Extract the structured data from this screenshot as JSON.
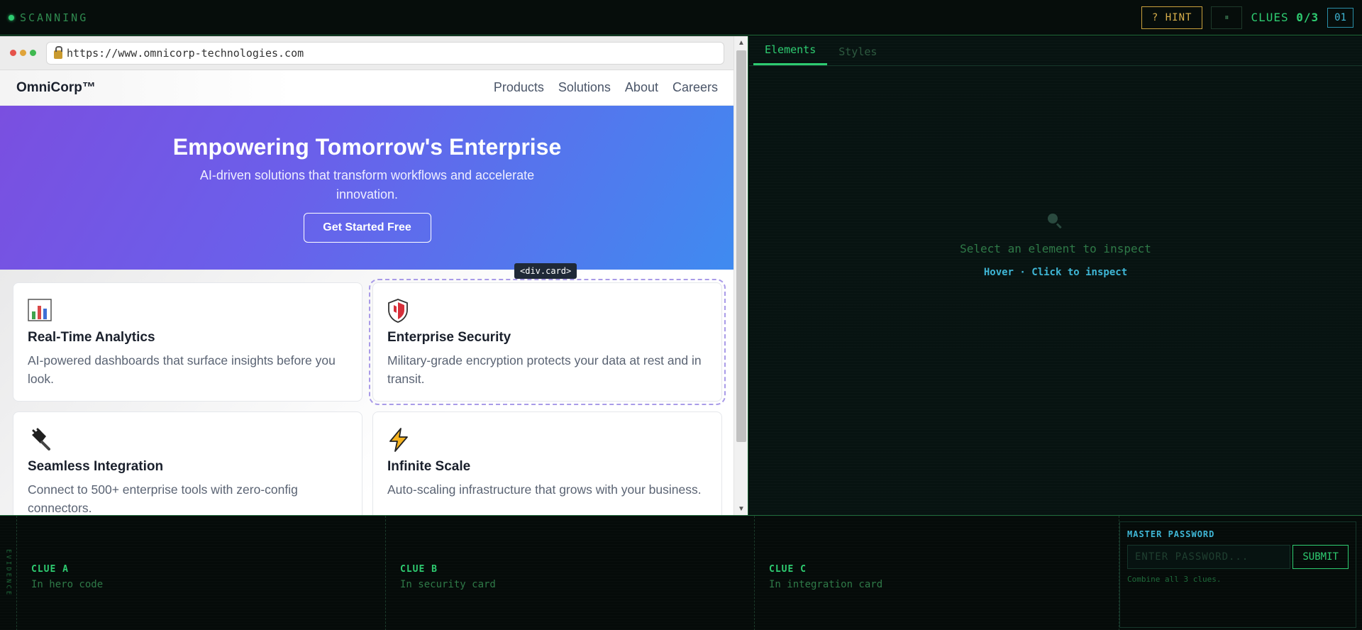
{
  "topbar": {
    "status": "SCANNING",
    "hint_label": "? HINT",
    "pause_label": "⏸",
    "clues_prefix": "CLUES ",
    "clues_count": "0/3",
    "timer": "01"
  },
  "browser": {
    "url": "https://www.omnicorp-technologies.com",
    "site": {
      "logo": "OmniCorp™",
      "nav": [
        "Products",
        "Solutions",
        "About",
        "Careers"
      ],
      "hero": {
        "title": "Empowering Tomorrow's Enterprise",
        "subtitle": "AI-driven solutions that transform workflows and accelerate innovation.",
        "cta": "Get Started Free"
      },
      "selected_tag": "<div.card>",
      "cards": [
        {
          "icon": "📊",
          "title": "Real-Time Analytics",
          "text": "AI-powered dashboards that surface insights before you look."
        },
        {
          "icon": "🛡️",
          "title": "Enterprise Security",
          "text": "Military-grade encryption protects your data at rest and in transit."
        },
        {
          "icon": "🔌",
          "title": "Seamless Integration",
          "text": "Connect to 500+ enterprise tools with zero-config connectors."
        },
        {
          "icon": "⚡",
          "title": "Infinite Scale",
          "text": "Auto-scaling infrastructure that grows with your business."
        }
      ]
    }
  },
  "devtools": {
    "tabs": [
      "Elements",
      "Styles"
    ],
    "empty_title": "Select an element to inspect",
    "empty_sub": "Hover · Click to inspect"
  },
  "evidence": {
    "label": "EVIDENCE",
    "clues": [
      {
        "title": "CLUE A",
        "text": "In hero code"
      },
      {
        "title": "CLUE B",
        "text": "In security card"
      },
      {
        "title": "CLUE C",
        "text": "In integration card"
      }
    ],
    "password": {
      "title": "MASTER PASSWORD",
      "placeholder": "ENTER PASSWORD...",
      "submit": "SUBMIT",
      "help": "Combine all 3 clues."
    }
  }
}
